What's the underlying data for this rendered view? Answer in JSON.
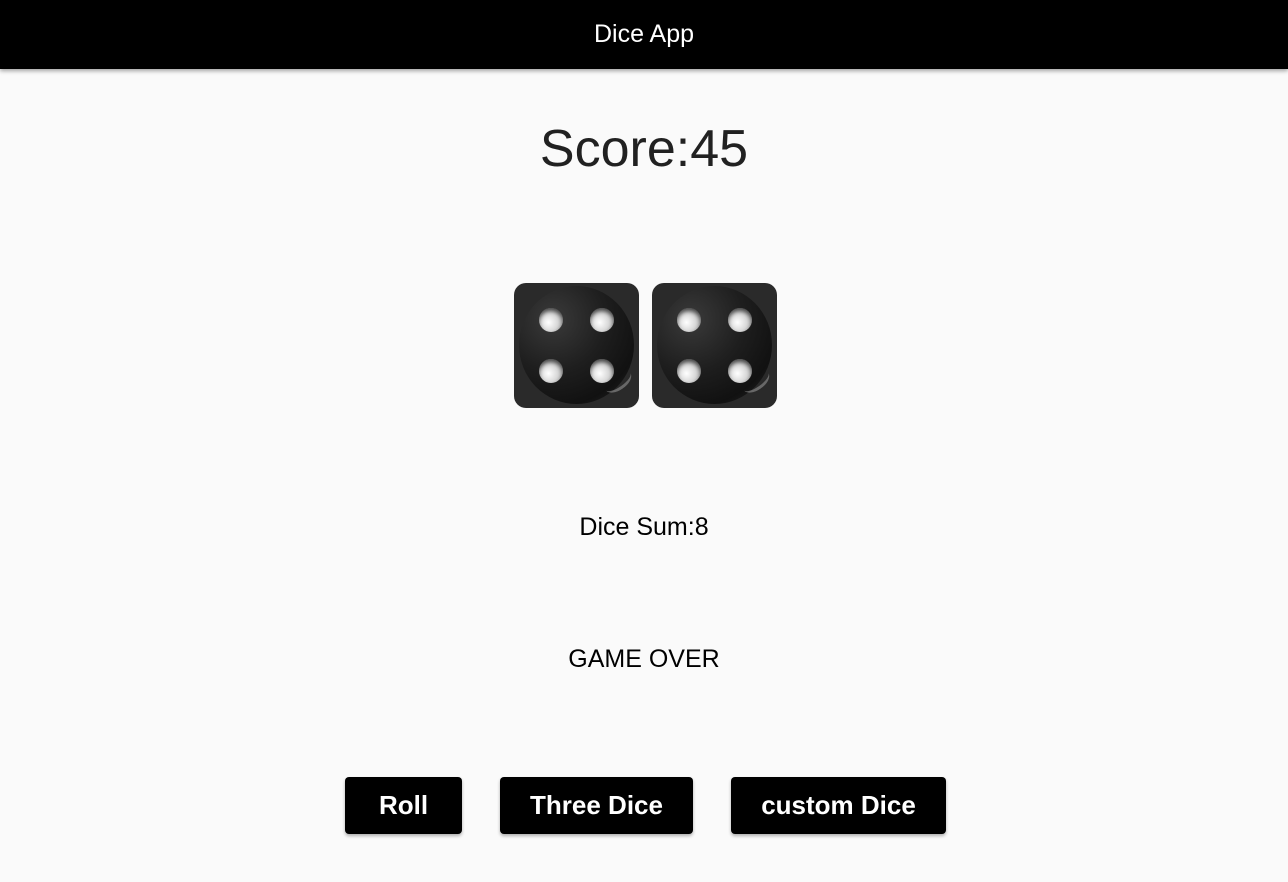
{
  "app_bar": {
    "title": "Dice App"
  },
  "score": {
    "text": "Score:45"
  },
  "dice": [
    {
      "face": 4
    },
    {
      "face": 4
    }
  ],
  "dice_sum": {
    "text": "Dice Sum:8"
  },
  "status": {
    "text": "GAME OVER"
  },
  "buttons": {
    "roll": "Roll",
    "three_dice": "Three Dice",
    "custom_dice": "custom Dice"
  },
  "colors": {
    "app_bar": "#000000",
    "background": "#fafafa",
    "button": "#000000",
    "button_text": "#ffffff"
  }
}
